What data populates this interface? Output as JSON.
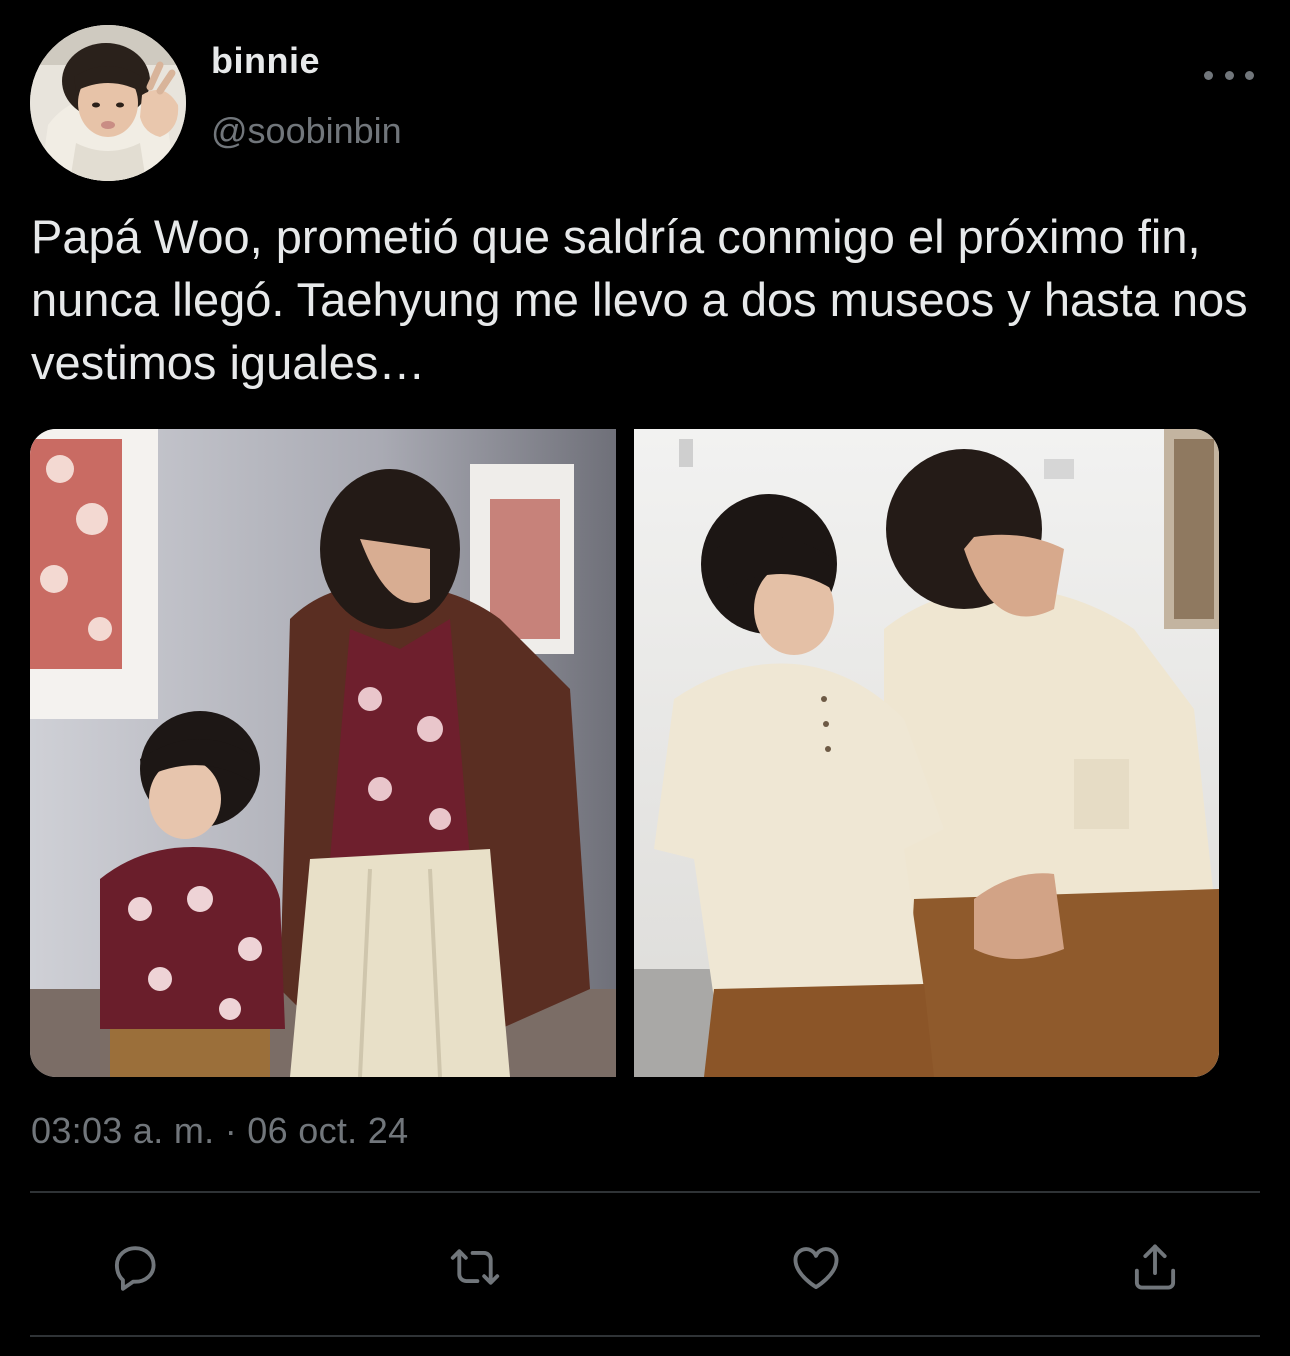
{
  "tweet": {
    "display_name": "binnie",
    "handle": "@soobinbin",
    "text": "Papá Woo, prometió que saldría conmigo el próximo fin, nunca llegó. Taehyung me llevo a dos museos y hasta nos vestimos iguales…",
    "timestamp": "03:03 a. m. · 06 oct. 24"
  },
  "icons": {
    "more": "more-horizontal-icon",
    "reply": "reply-icon",
    "retweet": "retweet-icon",
    "like": "heart-icon",
    "share": "share-icon"
  },
  "colors": {
    "background": "#000000",
    "text_primary": "#e7e9ea",
    "text_secondary": "#71767b",
    "divider": "#2f3336"
  }
}
